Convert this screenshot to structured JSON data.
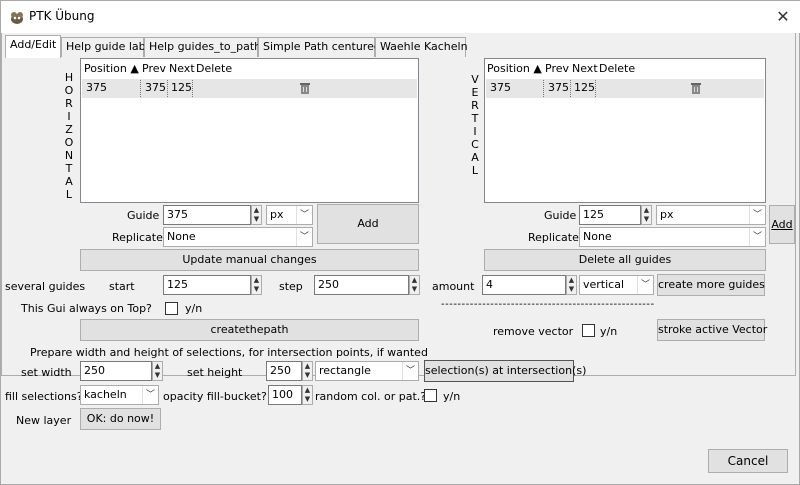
{
  "window": {
    "title": "PTK Übung",
    "close_glyph": "✕"
  },
  "tabs": [
    "Add/Edit",
    "Help guide lab",
    "Help guides_to_path",
    "Simple Path centured",
    "Waehle Kacheln"
  ],
  "horizontal": {
    "side_label": [
      "H",
      "O",
      "R",
      "I",
      "Z",
      "O",
      "N",
      "T",
      "A",
      "L"
    ],
    "columns": [
      "Position",
      "Prev",
      "Next",
      "Delete"
    ],
    "rows": [
      {
        "position": "375",
        "prev": "375",
        "next": "125"
      }
    ],
    "guide_label": "Guide",
    "guide_value": "375",
    "unit": "px",
    "replicate_label": "Replicate",
    "replicate_value": "None",
    "add_label": "Add"
  },
  "vertical": {
    "side_label": [
      "V",
      "E",
      "R",
      "T",
      "I",
      "C",
      "A",
      "L"
    ],
    "columns": [
      "Position",
      "Prev",
      "Next",
      "Delete"
    ],
    "rows": [
      {
        "position": "375",
        "prev": "375",
        "next": "125"
      }
    ],
    "guide_label": "Guide",
    "guide_value": "125",
    "unit": "px",
    "replicate_label": "Replicate",
    "replicate_value": "None",
    "add_label": "Add"
  },
  "update_button": "Update manual changes",
  "delete_all_button": "Delete all guides",
  "several": {
    "label": "several guides",
    "start_label": "start",
    "start_value": "125",
    "step_label": "step",
    "step_value": "250",
    "amount_label": "amount",
    "amount_value": "4",
    "direction": "vertical",
    "create_button": "create more guides"
  },
  "always_on_top": {
    "label": "This Gui always on Top?",
    "checkbox_label": "y/n"
  },
  "dashes": "----------------------------------------------------",
  "create_path_button": "createthepath",
  "remove_vector": {
    "label": "remove vector",
    "checkbox_label": "y/n"
  },
  "stroke_button": "stroke active Vector",
  "prepare_text": "Prepare width and height of selections, for intersection points, if wanted",
  "set_width": {
    "label": "set width",
    "value": "250"
  },
  "set_height": {
    "label": "set height",
    "value": "250",
    "shape": "rectangle"
  },
  "selection_button": "selection(s) at intersection(s)",
  "fill": {
    "label": "fill selections?!",
    "value": "kacheln",
    "opacity_label": "opacity fill-bucket?!",
    "opacity_value": "100",
    "random_label": "random col. or pat.?!",
    "random_checkbox_label": "y/n"
  },
  "new_layer": {
    "label": "New layer",
    "button": "OK: do now!"
  },
  "cancel_button": "Cancel",
  "icons": {
    "app": "gimp-icon",
    "trash": "trash-icon"
  }
}
